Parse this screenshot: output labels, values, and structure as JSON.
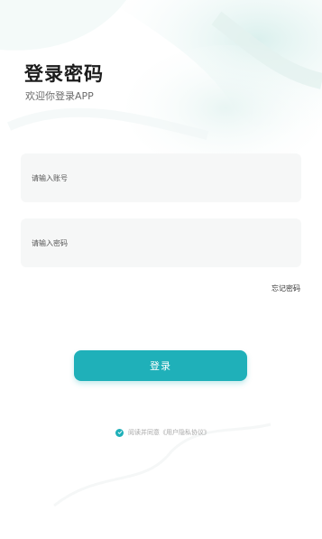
{
  "header": {
    "title": "登录密码",
    "subtitle": "欢迎你登录APP"
  },
  "form": {
    "account_placeholder": "请输入账号",
    "account_value": "",
    "password_placeholder": "请输入密码",
    "password_value": "",
    "forgot_label": "忘记密码",
    "login_label": "登录"
  },
  "agreement": {
    "checked": true,
    "prefix": "阅读并同意",
    "link": "《用户隐私协议》"
  },
  "colors": {
    "accent": "#1fb0b9",
    "field_bg": "#f6f7f7"
  },
  "icons": {
    "agreement_check": "check-circle-icon"
  }
}
